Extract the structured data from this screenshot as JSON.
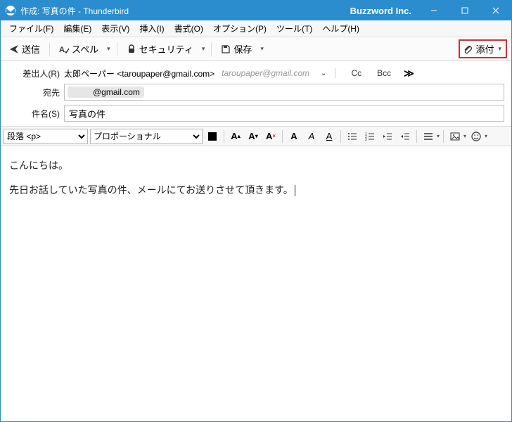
{
  "window": {
    "title": "作成: 写真の件 - Thunderbird",
    "brand": "Buzzword Inc."
  },
  "menu": {
    "file": "ファイル(F)",
    "edit": "編集(E)",
    "view": "表示(V)",
    "insert": "挿入(I)",
    "format": "書式(O)",
    "options": "オプション(P)",
    "tools": "ツール(T)",
    "help": "ヘルプ(H)"
  },
  "toolbar": {
    "send": "送信",
    "spell": "スペル",
    "security": "セキュリティ",
    "save": "保存",
    "attach": "添付"
  },
  "headers": {
    "from_label": "差出人(R)",
    "from_value": "太郎ペーパー <taroupaper@gmail.com>",
    "from_gray": "taroupaper@gmail.com",
    "to_label": "宛先",
    "to_value": "@gmail.com",
    "subject_label": "件名(S)",
    "subject_value": "写真の件",
    "cc": "Cc",
    "bcc": "Bcc"
  },
  "fmt": {
    "para": "段落 <p>",
    "font": "プロポーショナル"
  },
  "body": {
    "line1": "こんにちは。",
    "line2": "先日お話していた写真の件、メールにてお送りさせて頂きます。"
  }
}
